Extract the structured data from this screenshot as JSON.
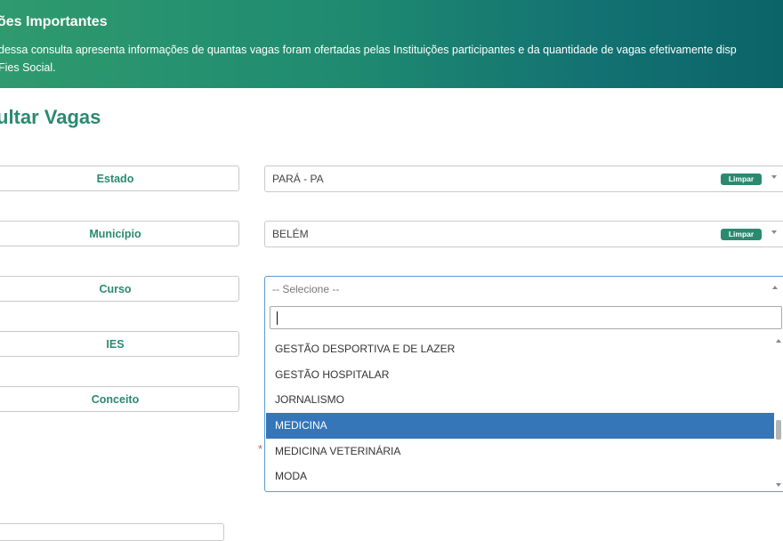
{
  "banner": {
    "title": "ões Importantes",
    "text_line1": "dessa consulta apresenta informações de quantas vagas foram ofertadas pelas Instituições participantes e da quantidade de vagas efetivamente disp",
    "text_line2": "Fies Social.",
    "background_colors": [
      "#2f9a6e",
      "#0b6468"
    ]
  },
  "page_title": "ultar Vagas",
  "filters": {
    "estado": {
      "label": "Estado",
      "value": "PARÁ - PA",
      "clear_label": "Limpar"
    },
    "municipio": {
      "label": "Município",
      "value": "BELÉM",
      "clear_label": "Limpar"
    },
    "curso": {
      "label": "Curso",
      "placeholder": "-- Selecione --",
      "search_value": ""
    },
    "ies": {
      "label": "IES"
    },
    "conceito": {
      "label": "Conceito"
    }
  },
  "curso_options": [
    "GESTÃO DESPORTIVA E DE LAZER",
    "GESTÃO HOSPITALAR",
    "JORNALISMO",
    "MEDICINA",
    "MEDICINA VETERINÁRIA",
    "MODA"
  ],
  "selected_option": "MEDICINA",
  "required_marker": "*",
  "colors": {
    "accent": "#2a8a70",
    "selection": "#3576b9",
    "focus_border": "#5b9bd5",
    "required": "#d9534f"
  },
  "icons": [
    "chevron-down-icon",
    "chevron-up-icon",
    "scroll-up-arrow-icon",
    "scroll-down-arrow-icon"
  ]
}
